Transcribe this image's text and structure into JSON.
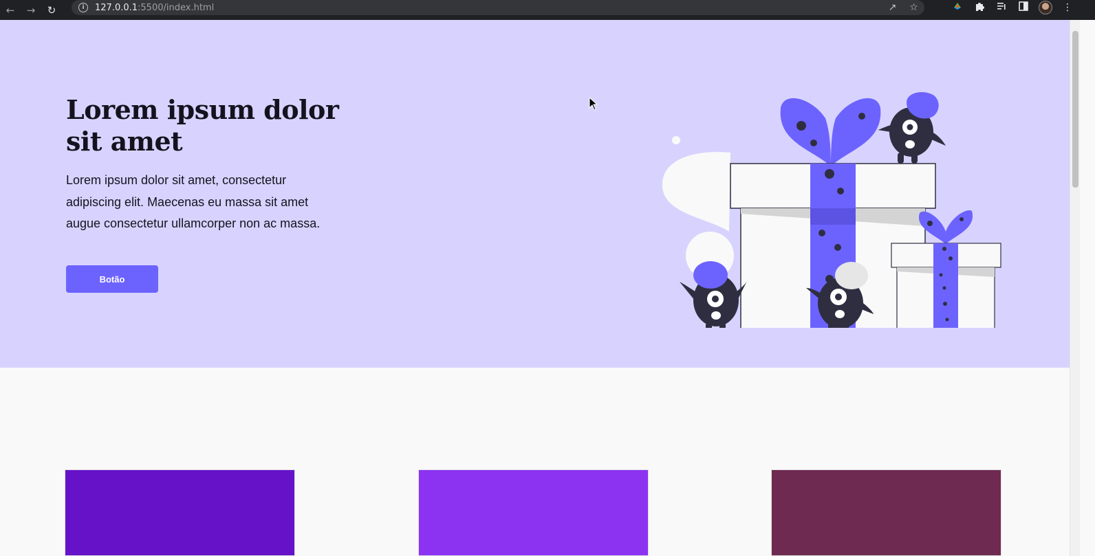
{
  "browser": {
    "url_host": "127.0.0.1",
    "url_rest": ":5500/index.html",
    "nav_icons": [
      "back-arrow-icon",
      "forward-arrow-icon",
      "reload-icon"
    ],
    "address_icons": [
      "share-icon",
      "bookmark-star-icon"
    ],
    "toolbar_icons": [
      "extension-color-icon",
      "puzzle-extensions-icon",
      "reading-list-icon",
      "side-panel-icon",
      "profile-avatar",
      "menu-kebab-icon"
    ]
  },
  "hero": {
    "title": "Lorem ipsum dolor sit amet",
    "text": "Lorem ipsum dolor sit amet, consectetur adipiscing elit. Maecenas eu massa sit amet augue consectetur ullamcorper non ac massa.",
    "button_label": "Botão",
    "background_color": "#d7d3fe",
    "accent_color": "#6c63ff",
    "illustration": "gift-boxes-monsters-illustration"
  },
  "cards": [
    {
      "color": "#6612c9"
    },
    {
      "color": "#8c33f1"
    },
    {
      "color": "#6e2a50"
    }
  ]
}
